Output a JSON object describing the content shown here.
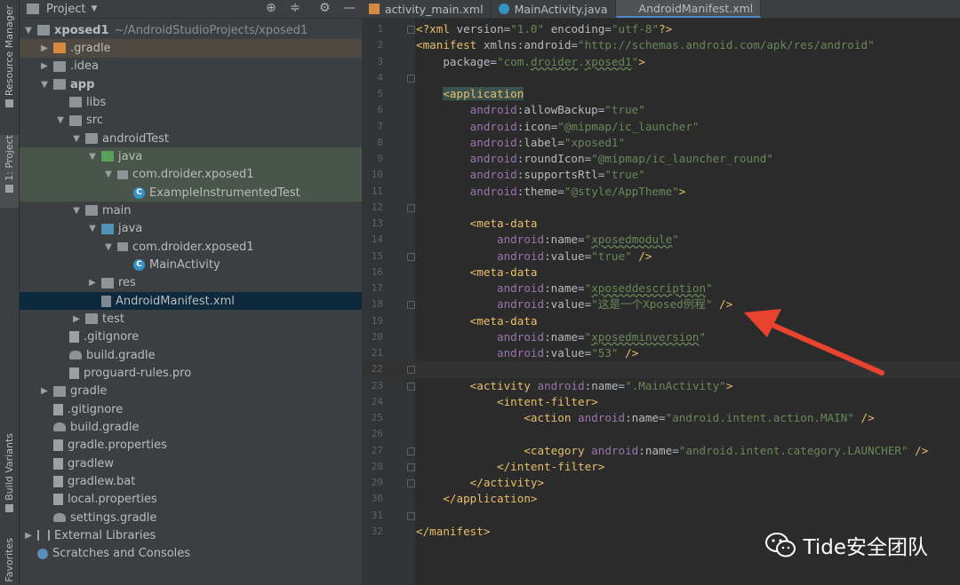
{
  "sidebar": {
    "resource_manager": "Resource Manager",
    "project_tab": "1: Project",
    "build_variants": "Build Variants",
    "favorites": "2: Favorites"
  },
  "panel": {
    "title": "Project",
    "icons": [
      "target-icon",
      "collapse-icon",
      "gear-icon",
      "hide-icon"
    ],
    "tree": [
      {
        "label": "xposed1",
        "path": "~/AndroidStudioProjects/xposed1",
        "depth": 0,
        "arrow": "down",
        "icon": "module"
      },
      {
        "label": ".gradle",
        "depth": 1,
        "arrow": "right",
        "icon": "folder-orange"
      },
      {
        "label": ".idea",
        "depth": 1,
        "arrow": "right",
        "icon": "folder"
      },
      {
        "label": "app",
        "depth": 1,
        "arrow": "down",
        "icon": "folder"
      },
      {
        "label": "libs",
        "depth": 2,
        "arrow": "",
        "icon": "folder"
      },
      {
        "label": "src",
        "depth": 2,
        "arrow": "down",
        "icon": "folder"
      },
      {
        "label": "androidTest",
        "depth": 3,
        "arrow": "down",
        "icon": "folder"
      },
      {
        "label": "java",
        "depth": 4,
        "arrow": "down",
        "icon": "folder-green"
      },
      {
        "label": "com.droider.xposed1",
        "depth": 5,
        "arrow": "down",
        "icon": "package"
      },
      {
        "label": "ExampleInstrumentedTest",
        "depth": 6,
        "arrow": "",
        "icon": "class"
      },
      {
        "label": "main",
        "depth": 3,
        "arrow": "down",
        "icon": "folder"
      },
      {
        "label": "java",
        "depth": 4,
        "arrow": "down",
        "icon": "folder-blue"
      },
      {
        "label": "com.droider.xposed1",
        "depth": 5,
        "arrow": "down",
        "icon": "package"
      },
      {
        "label": "MainActivity",
        "depth": 6,
        "arrow": "",
        "icon": "class"
      },
      {
        "label": "res",
        "depth": 4,
        "arrow": "right",
        "icon": "folder"
      },
      {
        "label": "AndroidManifest.xml",
        "depth": 4,
        "arrow": "",
        "icon": "manifest"
      },
      {
        "label": "test",
        "depth": 3,
        "arrow": "right",
        "icon": "folder"
      },
      {
        "label": ".gitignore",
        "depth": 2,
        "arrow": "",
        "icon": "file"
      },
      {
        "label": "build.gradle",
        "depth": 2,
        "arrow": "",
        "icon": "gradle"
      },
      {
        "label": "proguard-rules.pro",
        "depth": 2,
        "arrow": "",
        "icon": "file"
      },
      {
        "label": "gradle",
        "depth": 1,
        "arrow": "right",
        "icon": "folder"
      },
      {
        "label": ".gitignore",
        "depth": 1,
        "arrow": "",
        "icon": "file"
      },
      {
        "label": "build.gradle",
        "depth": 1,
        "arrow": "",
        "icon": "gradle"
      },
      {
        "label": "gradle.properties",
        "depth": 1,
        "arrow": "",
        "icon": "file"
      },
      {
        "label": "gradlew",
        "depth": 1,
        "arrow": "",
        "icon": "file"
      },
      {
        "label": "gradlew.bat",
        "depth": 1,
        "arrow": "",
        "icon": "file"
      },
      {
        "label": "local.properties",
        "depth": 1,
        "arrow": "",
        "icon": "file"
      },
      {
        "label": "settings.gradle",
        "depth": 1,
        "arrow": "",
        "icon": "gradle"
      },
      {
        "label": "External Libraries",
        "depth": 0,
        "arrow": "right",
        "icon": "libs"
      },
      {
        "label": "Scratches and Consoles",
        "depth": 0,
        "arrow": "",
        "icon": "scratch"
      }
    ]
  },
  "editor": {
    "tabs": [
      {
        "label": "activity_main.xml",
        "icon": "xml",
        "active": false
      },
      {
        "label": "MainActivity.java",
        "icon": "java",
        "active": false
      },
      {
        "label": "AndroidManifest.xml",
        "icon": "manifest",
        "active": true
      }
    ],
    "lines": [
      "<?xml version=\"1.0\" encoding=\"utf-8\"?>",
      "<manifest xmlns:android=\"http://schemas.android.com/apk/res/android\"",
      "    package=\"com.droider.xposed1\">",
      "",
      "    <application",
      "        android:allowBackup=\"true\"",
      "        android:icon=\"@mipmap/ic_launcher\"",
      "        android:label=\"xposed1\"",
      "        android:roundIcon=\"@mipmap/ic_launcher_round\"",
      "        android:supportsRtl=\"true\"",
      "        android:theme=\"@style/AppTheme\">",
      "",
      "        <meta-data",
      "            android:name=\"xposedmodule\"",
      "            android:value=\"true\" />",
      "        <meta-data",
      "            android:name=\"xposeddescription\"",
      "            android:value=\"这是一个Xposed例程\" />",
      "        <meta-data",
      "            android:name=\"xposedminversion\"",
      "            android:value=\"53\" />",
      "",
      "        <activity android:name=\".MainActivity\">",
      "            <intent-filter>",
      "                <action android:name=\"android.intent.action.MAIN\" />",
      "",
      "                <category android:name=\"android.intent.category.LAUNCHER\" />",
      "            </intent-filter>",
      "        </activity>",
      "    </application>",
      "",
      "</manifest>"
    ]
  },
  "watermark": {
    "text": "Tide安全团队"
  },
  "colors": {
    "tag": "#e8bf6a",
    "attr_ns": "#9876aa",
    "value": "#6a8759",
    "arrow": "#e8432e"
  }
}
